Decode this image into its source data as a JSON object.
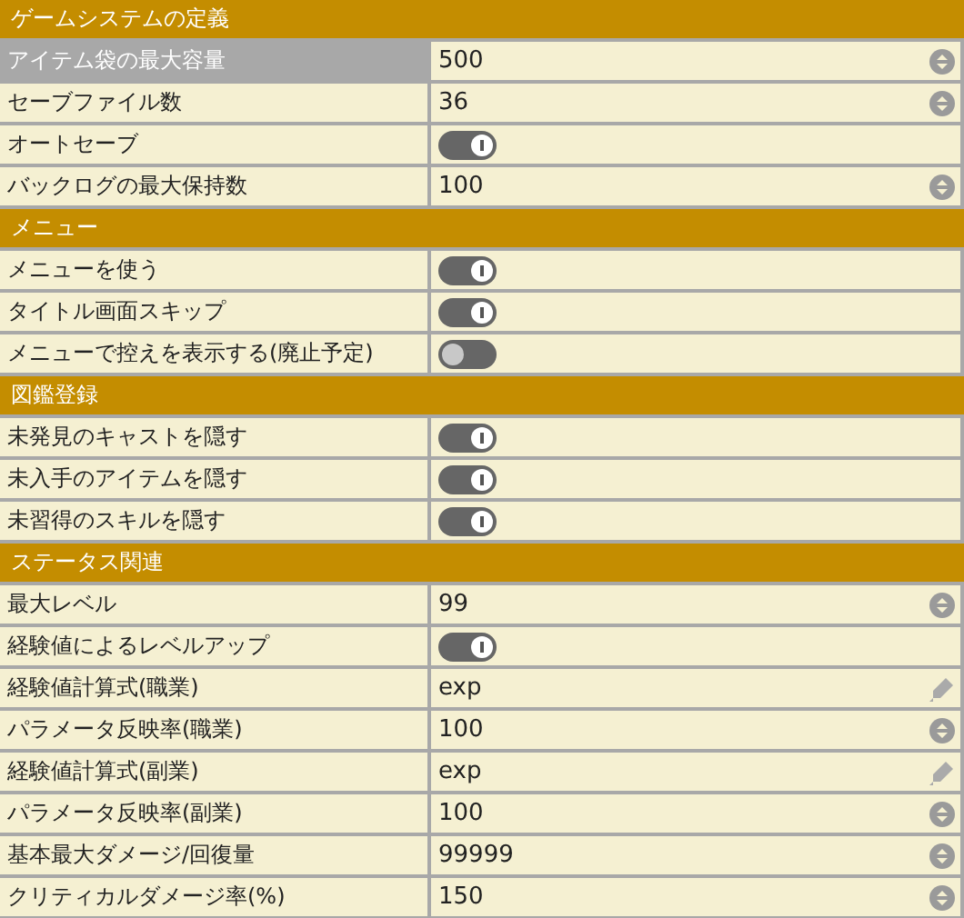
{
  "sections": [
    {
      "title": "ゲームシステムの定義",
      "rows": [
        {
          "label": "アイテム袋の最大容量",
          "kind": "number",
          "value": "500",
          "selected": true
        },
        {
          "label": "セーブファイル数",
          "kind": "number",
          "value": "36",
          "selected": false
        },
        {
          "label": "オートセーブ",
          "kind": "toggle",
          "on": true,
          "selected": false
        },
        {
          "label": "バックログの最大保持数",
          "kind": "number",
          "value": "100",
          "selected": false
        }
      ]
    },
    {
      "title": "メニュー",
      "rows": [
        {
          "label": "メニューを使う",
          "kind": "toggle",
          "on": true,
          "selected": false
        },
        {
          "label": "タイトル画面スキップ",
          "kind": "toggle",
          "on": true,
          "selected": false
        },
        {
          "label": "メニューで控えを表示する(廃止予定)",
          "kind": "toggle",
          "on": false,
          "selected": false
        }
      ]
    },
    {
      "title": "図鑑登録",
      "rows": [
        {
          "label": "未発見のキャストを隠す",
          "kind": "toggle",
          "on": true,
          "selected": false
        },
        {
          "label": "未入手のアイテムを隠す",
          "kind": "toggle",
          "on": true,
          "selected": false
        },
        {
          "label": "未習得のスキルを隠す",
          "kind": "toggle",
          "on": true,
          "selected": false
        }
      ]
    },
    {
      "title": "ステータス関連",
      "rows": [
        {
          "label": "最大レベル",
          "kind": "number",
          "value": "99",
          "selected": false
        },
        {
          "label": "経験値によるレベルアップ",
          "kind": "toggle",
          "on": true,
          "selected": false
        },
        {
          "label": "経験値計算式(職業)",
          "kind": "text",
          "value": "exp",
          "selected": false
        },
        {
          "label": "パラメータ反映率(職業)",
          "kind": "number",
          "value": "100",
          "selected": false
        },
        {
          "label": "経験値計算式(副業)",
          "kind": "text",
          "value": "exp",
          "selected": false
        },
        {
          "label": "パラメータ反映率(副業)",
          "kind": "number",
          "value": "100",
          "selected": false
        },
        {
          "label": "基本最大ダメージ/回復量",
          "kind": "number",
          "value": "99999",
          "selected": false
        },
        {
          "label": "クリティカルダメージ率(%)",
          "kind": "number",
          "value": "150",
          "selected": false
        }
      ]
    }
  ]
}
